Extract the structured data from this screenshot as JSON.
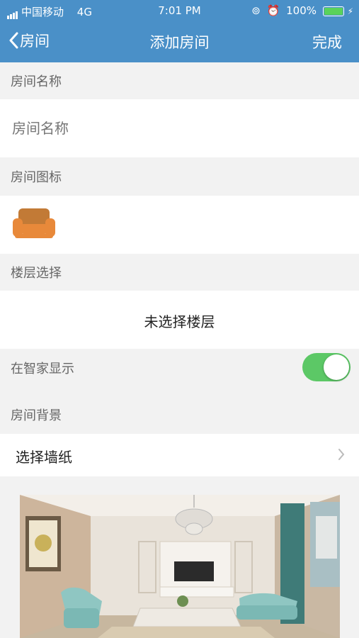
{
  "status_bar": {
    "carrier": "中国移动",
    "network": "4G",
    "time": "7:01 PM",
    "battery": "100%"
  },
  "nav": {
    "back_label": "房间",
    "title": "添加房间",
    "done_label": "完成"
  },
  "room_name": {
    "section_label": "房间名称",
    "placeholder": "房间名称",
    "value": ""
  },
  "room_icon": {
    "section_label": "房间图标",
    "icon": "sofa-icon"
  },
  "floor": {
    "section_label": "楼层选择",
    "value": "未选择楼层"
  },
  "smart_home": {
    "label": "在智家显示",
    "enabled": true
  },
  "background": {
    "section_label": "房间背景",
    "select_label": "选择墙纸",
    "image": "living-room-photo"
  },
  "colors": {
    "header": "#4a90c8",
    "toggle_on": "#5cc866",
    "icon": "#e8893a"
  }
}
